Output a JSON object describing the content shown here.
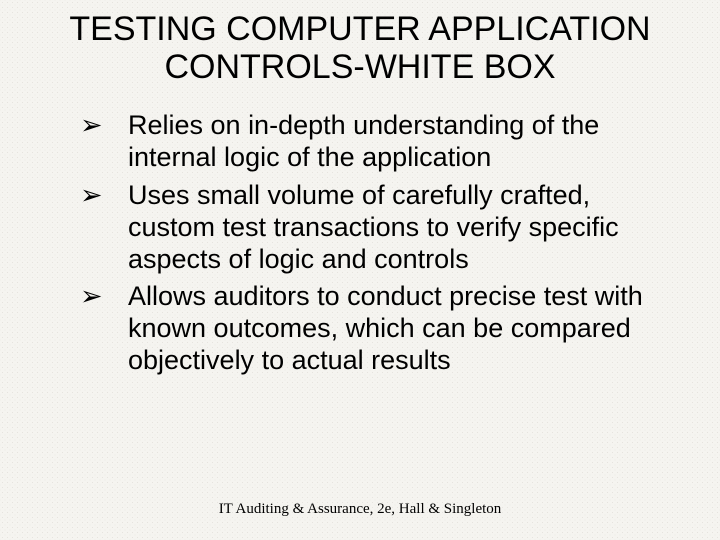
{
  "title": "TESTING COMPUTER APPLICATION CONTROLS-WHITE BOX",
  "bullet_marker": "➢",
  "bullets": [
    "Relies on in-depth understanding of the internal logic of the application",
    "Uses small volume of carefully crafted, custom test transactions to verify specific aspects of logic and controls",
    "Allows auditors to conduct precise test with known outcomes, which can be compared objectively to actual results"
  ],
  "footer": "IT Auditing & Assurance, 2e, Hall & Singleton"
}
